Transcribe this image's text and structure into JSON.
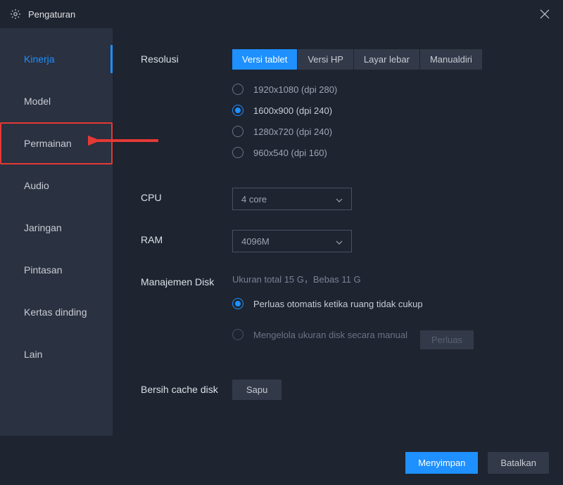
{
  "window": {
    "title": "Pengaturan"
  },
  "sidebar": {
    "items": [
      {
        "label": "Kinerja",
        "active": true
      },
      {
        "label": "Model"
      },
      {
        "label": "Permainan",
        "highlighted": true
      },
      {
        "label": "Audio"
      },
      {
        "label": "Jaringan"
      },
      {
        "label": "Pintasan"
      },
      {
        "label": "Kertas dinding"
      },
      {
        "label": "Lain"
      }
    ]
  },
  "resolution": {
    "label": "Resolusi",
    "tabs": [
      {
        "label": "Versi tablet",
        "active": true
      },
      {
        "label": "Versi HP"
      },
      {
        "label": "Layar lebar"
      },
      {
        "label": "Manualdiri"
      }
    ],
    "options": [
      {
        "label": "1920x1080  (dpi 280)"
      },
      {
        "label": "1600x900  (dpi 240)",
        "selected": true
      },
      {
        "label": "1280x720  (dpi 240)"
      },
      {
        "label": "960x540  (dpi 160)"
      }
    ]
  },
  "cpu": {
    "label": "CPU",
    "value": "4 core"
  },
  "ram": {
    "label": "RAM",
    "value": "4096M"
  },
  "disk": {
    "label": "Manajemen Disk",
    "info": "Ukuran total 15 G，Bebas 11 G",
    "options": [
      {
        "label": "Perluas otomatis ketika ruang tidak cukup",
        "selected": true
      },
      {
        "label": "Mengelola ukuran disk secara manual",
        "disabled": true
      }
    ],
    "expand_btn": "Perluas"
  },
  "cache": {
    "label": "Bersih cache disk",
    "btn": "Sapu"
  },
  "footer": {
    "save": "Menyimpan",
    "cancel": "Batalkan"
  }
}
